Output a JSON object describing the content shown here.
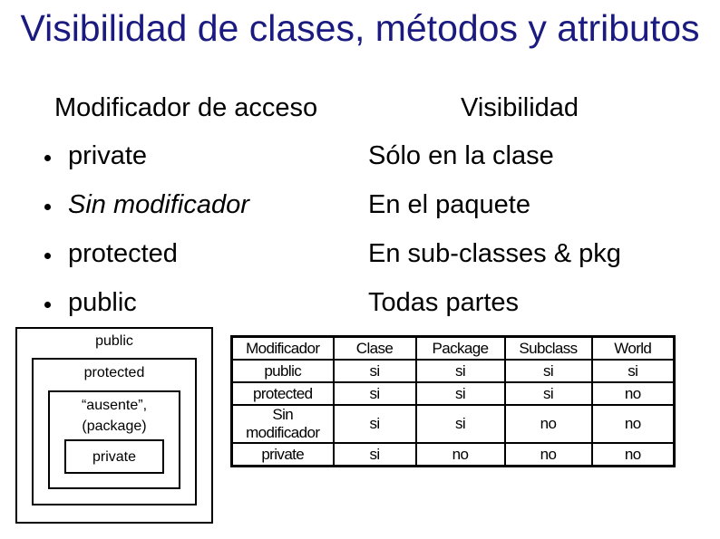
{
  "title": "Visibilidad de clases, métodos y atributos",
  "headers": {
    "left": "Modificador de acceso",
    "right": "Visibilidad"
  },
  "rows": [
    {
      "modifier": "private",
      "visibility": "Sólo en la clase",
      "italic": false
    },
    {
      "modifier": "Sin modificador",
      "visibility": "En el paquete",
      "italic": true
    },
    {
      "modifier": "protected",
      "visibility": "En sub-classes & pkg",
      "italic": false
    },
    {
      "modifier": "public",
      "visibility": "Todas partes",
      "italic": false
    }
  ],
  "diagram": {
    "public": "public",
    "protected": "protected",
    "package_line1": "“ausente”,",
    "package_line2": "(package)",
    "private": "private"
  },
  "table": {
    "columns": [
      "Modificador",
      "Clase",
      "Package",
      "Subclass",
      "World"
    ],
    "rows": [
      [
        "public",
        "si",
        "si",
        "si",
        "si"
      ],
      [
        "protected",
        "si",
        "si",
        "si",
        "no"
      ],
      [
        "Sin modificador",
        "si",
        "si",
        "no",
        "no"
      ],
      [
        "private",
        "si",
        "no",
        "no",
        "no"
      ]
    ]
  },
  "colors": {
    "title": "#1a1a80",
    "text": "#000000",
    "background": "#ffffff"
  }
}
